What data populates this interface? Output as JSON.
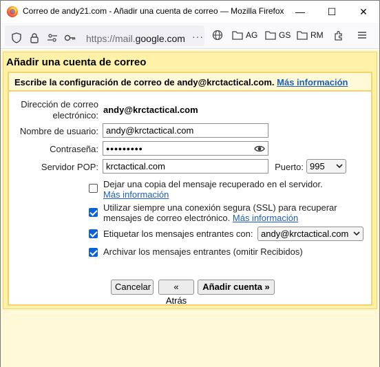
{
  "window": {
    "title": "Correo de andy21.com - Añadir una cuenta de correo — Mozilla Firefox",
    "minimize": "—",
    "maximize": "☐",
    "close": "✕"
  },
  "toolbar": {
    "url_prefix": "https://mail.",
    "url_domain": "google.com",
    "more": "···",
    "bookmarks": [
      {
        "label": "AG",
        "icon": "folder-icon"
      },
      {
        "label": "GS",
        "icon": "folder-icon"
      },
      {
        "label": "RM",
        "icon": "folder-icon"
      }
    ]
  },
  "dialog": {
    "title": "Añadir una cuenta de correo",
    "subhead_text": "Escribe la configuración de correo de andy@krctactical.com.",
    "subhead_link": "Más información",
    "email_label_line1": "Dirección de correo",
    "email_label_line2": "electrónico:",
    "email_value": "andy@krctactical.com",
    "username_label": "Nombre de usuario:",
    "username_value": "andy@krctactical.com",
    "password_label": "Contraseña:",
    "password_value": "●●●●●●●●●",
    "pop_label": "Servidor POP:",
    "pop_value": "krctactical.com",
    "port_label": "Puerto:",
    "port_value": "995",
    "options": [
      {
        "line1": "Dejar una copia del mensaje recuperado en el servidor.",
        "line2_link": "Más información",
        "checked": false
      },
      {
        "line1": "Utilizar siempre una conexión segura (SSL) para recuperar",
        "line2": "mensajes de correo electrónico.",
        "line2_link": "Más información",
        "checked": true
      },
      {
        "line1": "Etiquetar los mensajes entrantes con:",
        "select_value": "andy@krctactical.com",
        "checked": true
      },
      {
        "line1": "Archivar los mensajes entrantes (omitir Recibidos)",
        "checked": true
      }
    ],
    "cancel_label": "Cancelar",
    "back_label": "« Atrás",
    "add_label": "Añadir cuenta »"
  },
  "colors": {
    "panel_bg": "#fff1a8",
    "panel_border": "#f6d36a",
    "link": "#1c5fb8",
    "checkbox": "#0b62d6"
  }
}
